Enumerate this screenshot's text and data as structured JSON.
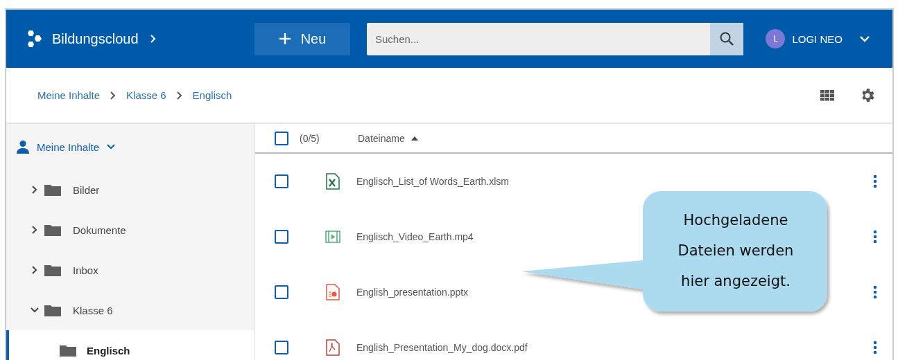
{
  "header": {
    "brand": "Bildungscloud",
    "new_button": "Neu",
    "search": {
      "placeholder": "Suchen..."
    },
    "user": {
      "initial": "L",
      "name": "LOGI NEO"
    }
  },
  "breadcrumb": [
    "Meine Inhalte",
    "Klasse 6",
    "Englisch"
  ],
  "sidebar": {
    "root": {
      "label": "Meine Inhalte",
      "expanded": true,
      "children": [
        {
          "label": "Bilder",
          "expanded": false,
          "selected": false
        },
        {
          "label": "Dokumente",
          "expanded": false,
          "selected": false
        },
        {
          "label": "Inbox",
          "expanded": false,
          "selected": false
        },
        {
          "label": "Klasse 6",
          "expanded": true,
          "selected": false,
          "children": [
            {
              "label": "Englisch",
              "selected": true
            }
          ]
        }
      ]
    }
  },
  "table": {
    "select_all": {
      "checked": false
    },
    "count": "(0/5)",
    "column": "Dateiname",
    "files": [
      {
        "kind": "spreadsheet",
        "name": "Englisch_List_of Words_Earth.xlsm",
        "checked": false
      },
      {
        "kind": "video",
        "name": "Englisch_Video_Earth.mp4",
        "checked": false
      },
      {
        "kind": "presentation",
        "name": "English_presentation.pptx",
        "checked": false
      },
      {
        "kind": "pdf",
        "name": "English_Presentation_My_dog.docx.pdf",
        "checked": false
      }
    ]
  },
  "callout": "Hochgeladene Dateien werden hier angezeigt."
}
